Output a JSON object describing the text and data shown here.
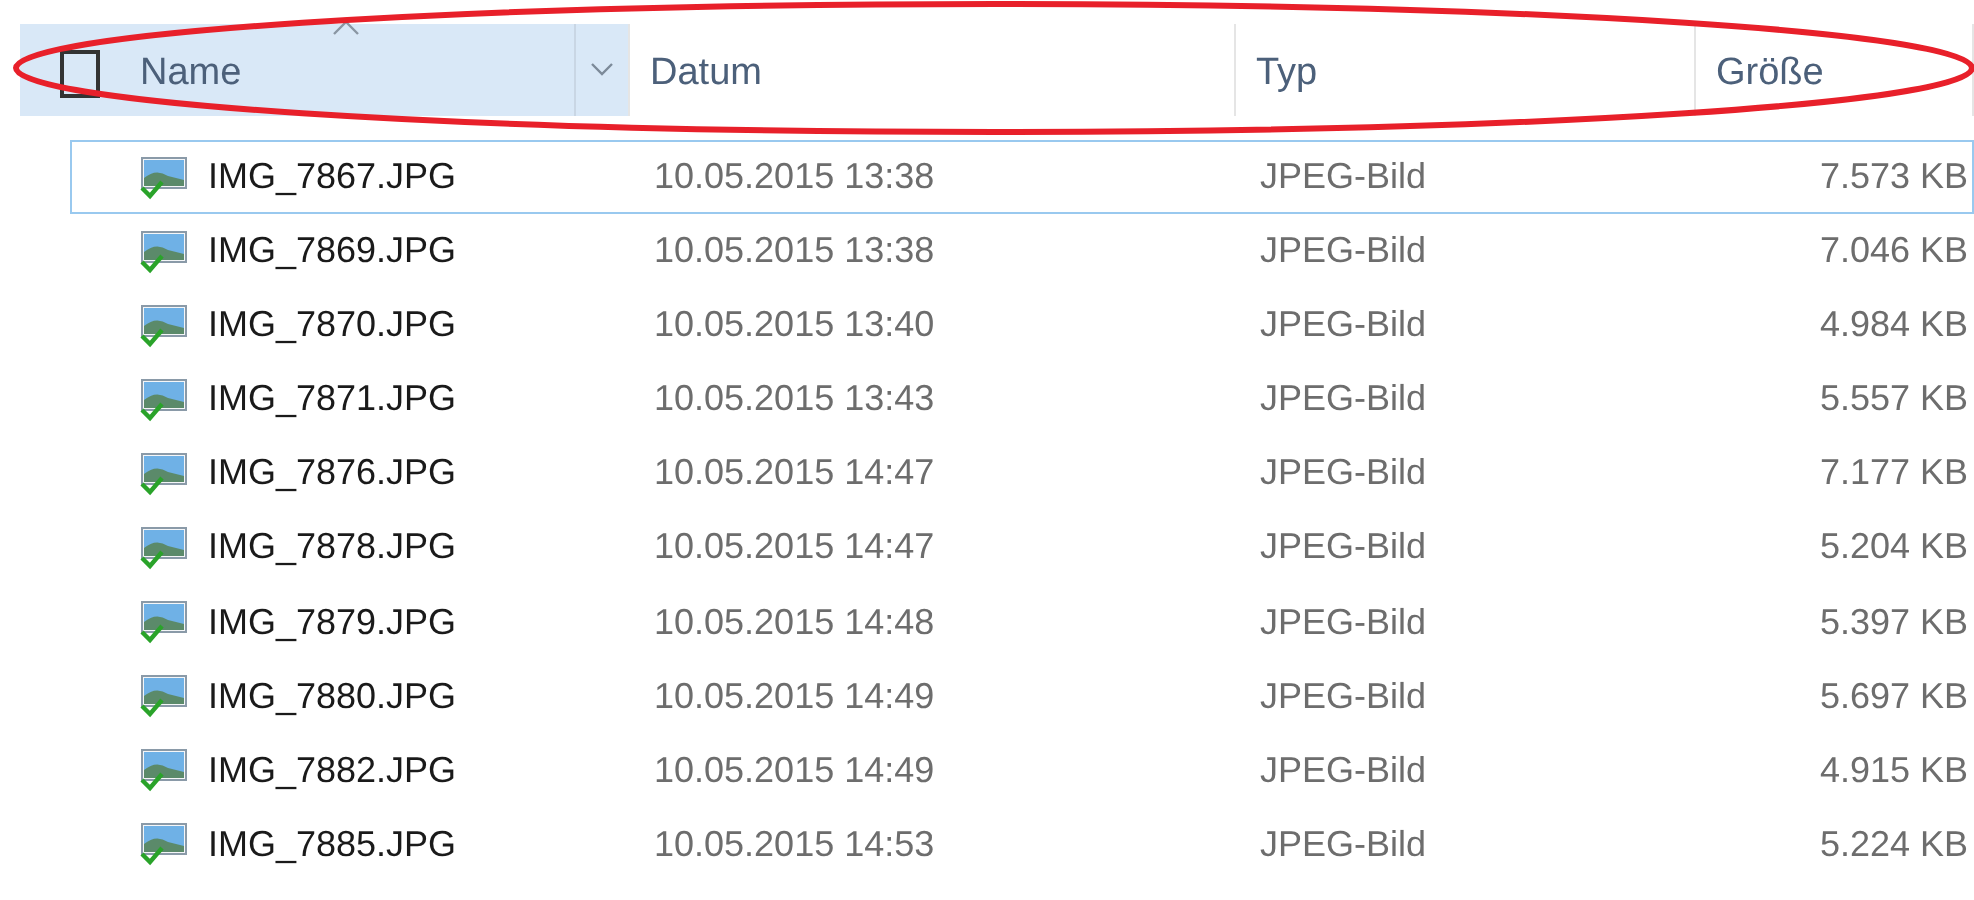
{
  "select_all": {
    "checked": false
  },
  "columns": [
    {
      "label": "Name",
      "selected": true,
      "sorted": true
    },
    {
      "label": "Datum",
      "selected": false,
      "sorted": false
    },
    {
      "label": "Typ",
      "selected": false,
      "sorted": false
    },
    {
      "label": "Größe",
      "selected": false,
      "sorted": false
    }
  ],
  "rows": [
    {
      "name": "IMG_7867.JPG",
      "date": "10.05.2015 13:38",
      "type": "JPEG-Bild",
      "size": "7.573 KB",
      "focused": true
    },
    {
      "name": "IMG_7869.JPG",
      "date": "10.05.2015 13:38",
      "type": "JPEG-Bild",
      "size": "7.046 KB",
      "focused": false
    },
    {
      "name": "IMG_7870.JPG",
      "date": "10.05.2015 13:40",
      "type": "JPEG-Bild",
      "size": "4.984 KB",
      "focused": false
    },
    {
      "name": "IMG_7871.JPG",
      "date": "10.05.2015 13:43",
      "type": "JPEG-Bild",
      "size": "5.557 KB",
      "focused": false
    },
    {
      "name": "IMG_7876.JPG",
      "date": "10.05.2015 14:47",
      "type": "JPEG-Bild",
      "size": "7.177 KB",
      "focused": false
    },
    {
      "name": "IMG_7878.JPG",
      "date": "10.05.2015 14:47",
      "type": "JPEG-Bild",
      "size": "5.204 KB",
      "focused": false
    },
    {
      "name": "IMG_7879.JPG",
      "date": "10.05.2015 14:48",
      "type": "JPEG-Bild",
      "size": "5.397 KB",
      "focused": false
    },
    {
      "name": "IMG_7880.JPG",
      "date": "10.05.2015 14:49",
      "type": "JPEG-Bild",
      "size": "5.697 KB",
      "focused": false
    },
    {
      "name": "IMG_7882.JPG",
      "date": "10.05.2015 14:49",
      "type": "JPEG-Bild",
      "size": "4.915 KB",
      "focused": false
    },
    {
      "name": "IMG_7885.JPG",
      "date": "10.05.2015 14:53",
      "type": "JPEG-Bild",
      "size": "5.224 KB",
      "focused": false
    }
  ]
}
